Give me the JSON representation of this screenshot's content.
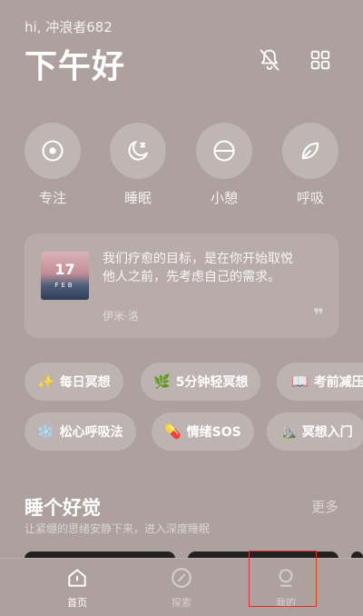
{
  "header": {
    "greeting_sub": "hi, 冲浪者682",
    "greeting_main": "下午好"
  },
  "icons": {
    "mute": "mute-icon",
    "grid": "grid-icon"
  },
  "categories": [
    {
      "label": "专注",
      "icon": "target-icon"
    },
    {
      "label": "睡眠",
      "icon": "moon-icon"
    },
    {
      "label": "小憩",
      "icon": "half-circle-icon"
    },
    {
      "label": "呼吸",
      "icon": "leaf-icon"
    }
  ],
  "quote": {
    "day": "17",
    "month": "FEB",
    "text": "我们疗愈的目标，是在你开始取悦他人之前，先考虑自己的需求。",
    "author": "伊米·洛",
    "mark": "❞"
  },
  "chips_row1": [
    {
      "emoji": "✨",
      "label": "每日冥想"
    },
    {
      "emoji": "🌿",
      "label": "5分钟轻冥想"
    },
    {
      "emoji": "📖",
      "label": "考前减压"
    }
  ],
  "chips_row2": [
    {
      "emoji": "❄️",
      "label": "松心呼吸法"
    },
    {
      "emoji": "💊",
      "label": "情绪SOS"
    },
    {
      "emoji": "⛰️",
      "label": "冥想入门"
    }
  ],
  "section": {
    "title": "睡个好觉",
    "subtitle": "让紧绷的思绪安静下来，进入深度睡眠",
    "more": "更多"
  },
  "nav": [
    {
      "label": "首页",
      "icon": "home-icon"
    },
    {
      "label": "探索",
      "icon": "compass-icon"
    },
    {
      "label": "我的",
      "icon": "profile-icon"
    }
  ],
  "colors": {
    "background": "#ada19d",
    "highlight": "#e0302a"
  }
}
